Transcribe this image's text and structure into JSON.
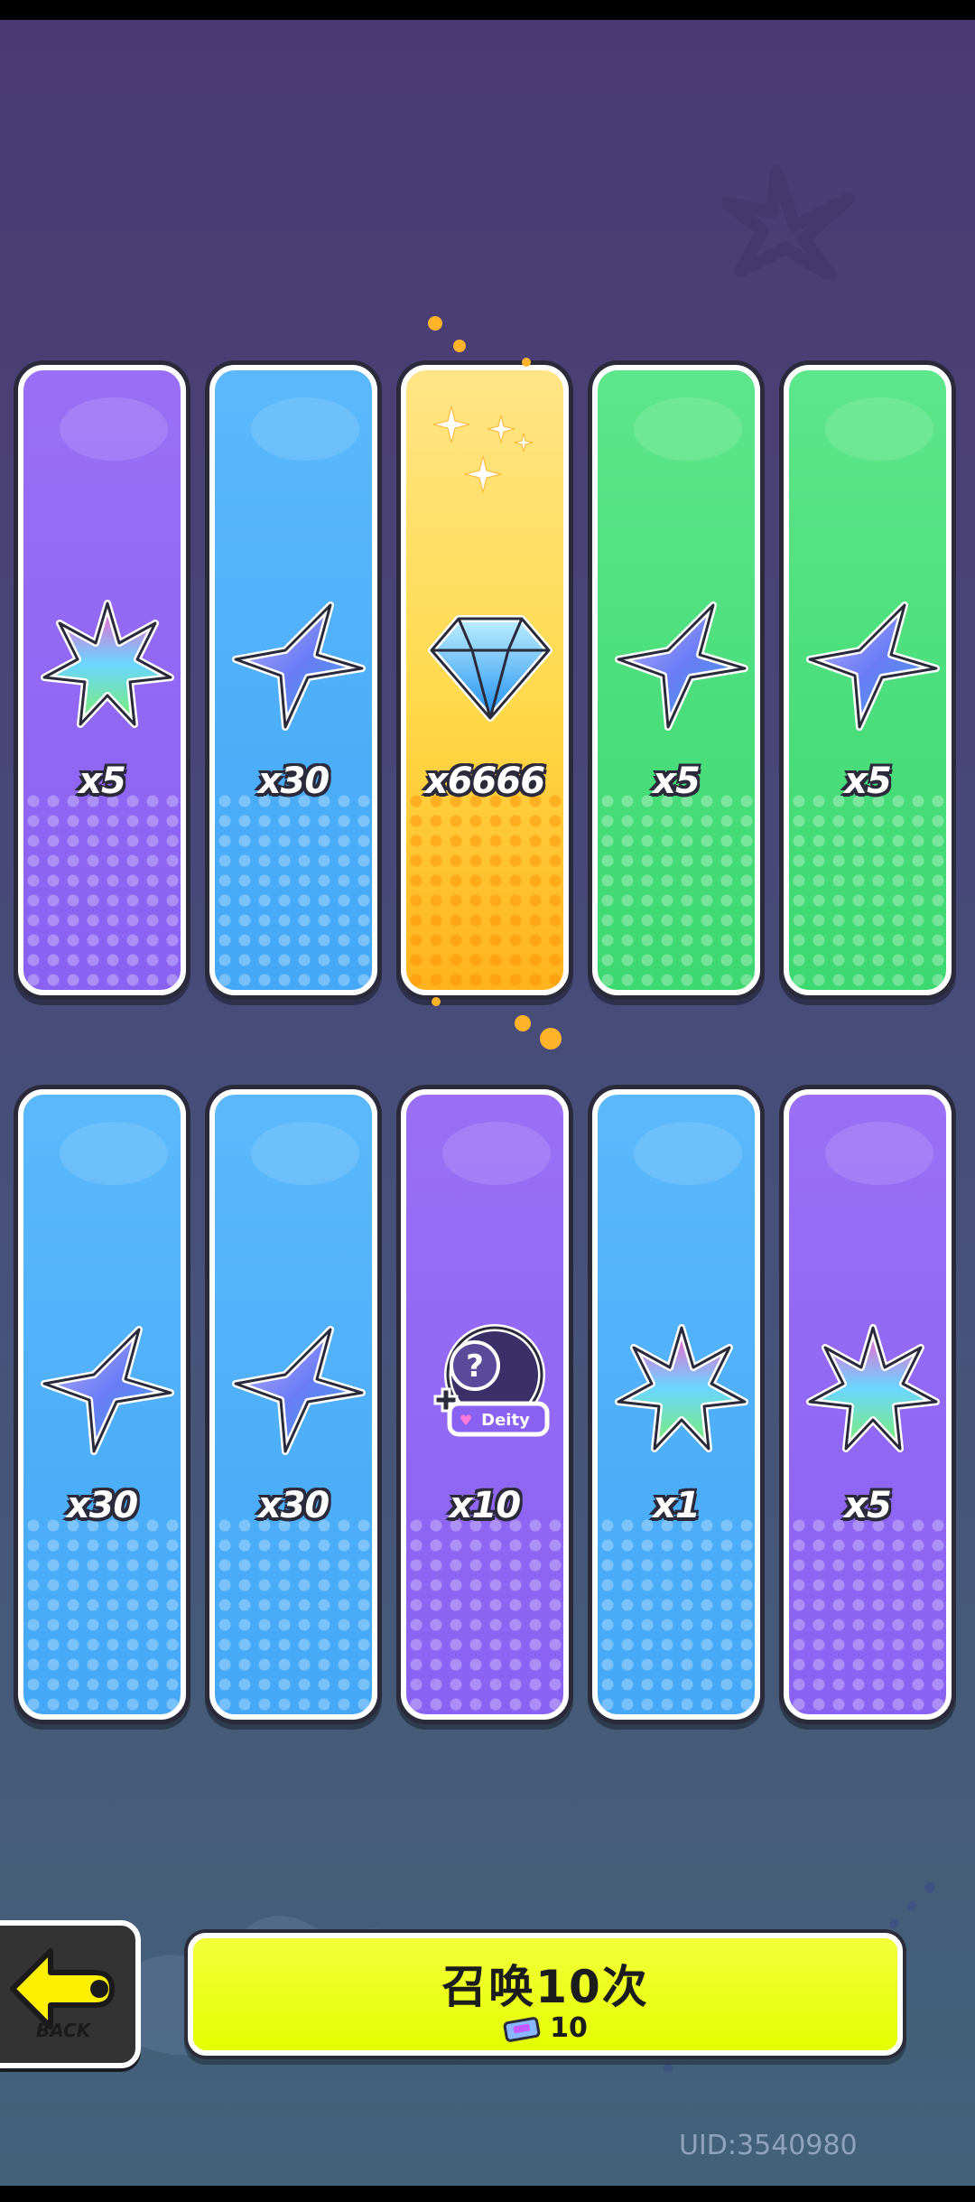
{
  "rewards": [
    {
      "quantity": "x5",
      "color": "purple",
      "icon": "rainbow-crystal-icon"
    },
    {
      "quantity": "x30",
      "color": "blue",
      "icon": "blue-star-crystal-icon"
    },
    {
      "quantity": "x6666",
      "color": "gold",
      "icon": "diamond-gem-icon"
    },
    {
      "quantity": "x5",
      "color": "green",
      "icon": "blue-star-crystal-icon"
    },
    {
      "quantity": "x5",
      "color": "green",
      "icon": "blue-star-crystal-icon"
    },
    {
      "quantity": "x30",
      "color": "blue",
      "icon": "blue-star-crystal-icon"
    },
    {
      "quantity": "x30",
      "color": "blue",
      "icon": "blue-star-crystal-icon"
    },
    {
      "quantity": "x10",
      "color": "purple",
      "icon": "mystery-deity-badge-icon"
    },
    {
      "quantity": "x1",
      "color": "blue",
      "icon": "rainbow-crystal-icon"
    },
    {
      "quantity": "x5",
      "color": "purple",
      "icon": "rainbow-crystal-icon"
    }
  ],
  "deity_badge_text": "Deity",
  "back_button": {
    "label": "BACK",
    "icon": "arrow-left-icon"
  },
  "summon_button": {
    "title": "召唤10次",
    "cost": "10",
    "cost_icon": "ticket-icon"
  },
  "uid": "UID:3540980",
  "colors": {
    "purple": "#8a62f2",
    "blue": "#44a8f7",
    "green": "#3cd870",
    "gold": "#ffd94a",
    "button": "#e3ff00"
  }
}
